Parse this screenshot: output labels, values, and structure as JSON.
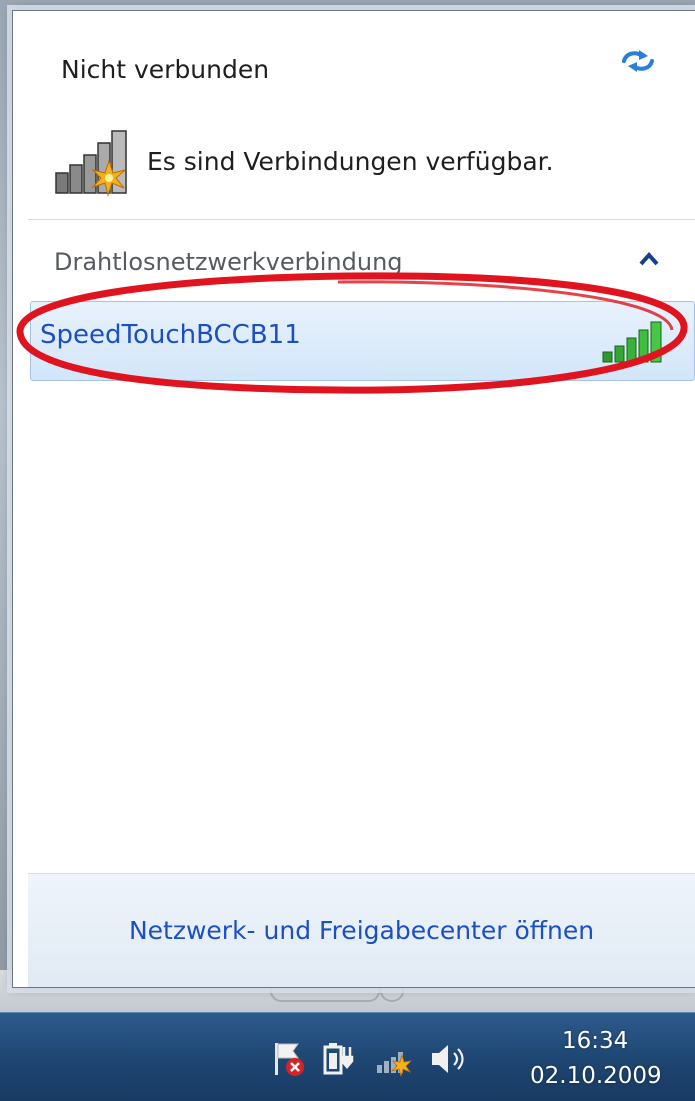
{
  "popup": {
    "status_title": "Nicht verbunden",
    "availability_text": "Es sind Verbindungen verfügbar.",
    "section_header": "Drahtlosnetzwerkverbindung",
    "networks": [
      {
        "name": "SpeedTouchBCCB11",
        "signal_bars": 5
      }
    ],
    "footer_link": "Netzwerk- und Freigabecenter öffnen"
  },
  "taskbar": {
    "clock_time": "16:34",
    "clock_date": "02.10.2009",
    "tray_icons": [
      "action-center-flag-icon",
      "power-icon",
      "network-icon",
      "volume-icon"
    ]
  },
  "colors": {
    "link_blue": "#1d4fc4",
    "selection_bg": "#d2e6fa",
    "highlight_red": "#e0141e",
    "signal_green": "#2e9a2e",
    "taskbar_blue": "#1f4774"
  }
}
